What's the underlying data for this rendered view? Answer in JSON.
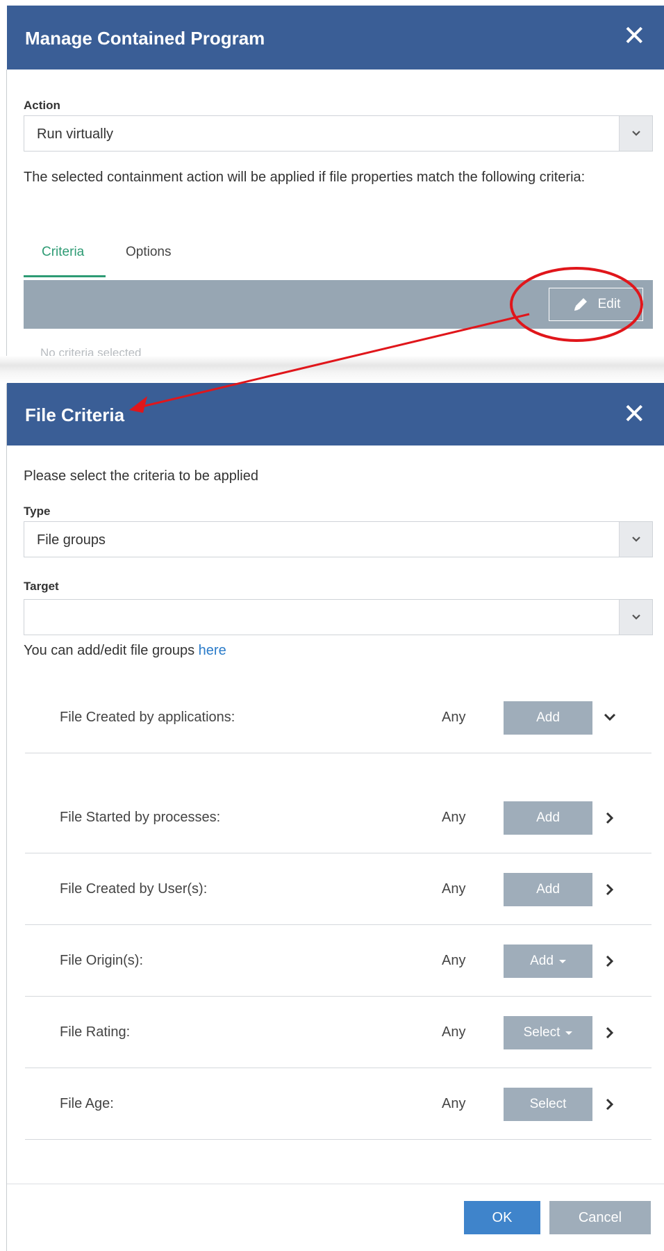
{
  "manage_dialog": {
    "title": "Manage Contained Program",
    "action_label": "Action",
    "action_value": "Run virtually",
    "description": "The selected containment action will be applied if file properties match the following criteria:",
    "tabs": [
      {
        "label": "Criteria",
        "active": true
      },
      {
        "label": "Options",
        "active": false
      }
    ],
    "edit_button": "Edit",
    "empty_message": "No criteria selected"
  },
  "file_criteria_dialog": {
    "title": "File Criteria",
    "instruction": "Please select the criteria to be applied",
    "type_label": "Type",
    "type_value": "File groups",
    "target_label": "Target",
    "target_value": "",
    "help_text": "You can add/edit file groups ",
    "help_link": "here",
    "rows": [
      {
        "label": "File Created by applications:",
        "value": "Any",
        "button": "Add",
        "dropdown": false,
        "chevron": "down"
      },
      {
        "label": "File Started by processes:",
        "value": "Any",
        "button": "Add",
        "dropdown": false,
        "chevron": "right"
      },
      {
        "label": "File Created by User(s):",
        "value": "Any",
        "button": "Add",
        "dropdown": false,
        "chevron": "right"
      },
      {
        "label": "File Origin(s):",
        "value": "Any",
        "button": "Add",
        "dropdown": true,
        "chevron": "right"
      },
      {
        "label": "File Rating:",
        "value": "Any",
        "button": "Select",
        "dropdown": true,
        "chevron": "right"
      },
      {
        "label": "File Age:",
        "value": "Any",
        "button": "Select",
        "dropdown": false,
        "chevron": "right"
      }
    ],
    "ok_button": "OK",
    "cancel_button": "Cancel"
  },
  "icons": [
    "close-icon",
    "chevron-down-icon",
    "pencil-icon",
    "chevron-right-icon",
    "caret-down-icon"
  ],
  "colors": {
    "header": "#3a5e96",
    "accent_tab": "#2e9b74",
    "button_gray": "#9fadba",
    "ok_blue": "#3f84cb",
    "annotation_red": "#e0161b"
  }
}
